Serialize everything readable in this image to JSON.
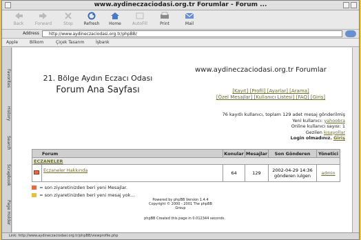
{
  "window": {
    "title": "www.aydineczaciodasi.org.tr Forumlar - Forum ..."
  },
  "toolbar": {
    "back": "Back",
    "forward": "Forward",
    "stop": "Stop",
    "refresh": "Refresh",
    "home": "Home",
    "autofill": "AutoFill",
    "print": "Print",
    "mail": "Mail"
  },
  "address": {
    "label": "Address",
    "url": "http://www.aydineczaciodasi.org.tr/phpBB/"
  },
  "bookmarks": [
    "Apple",
    "Bilkom",
    "Çiçek Tasarım",
    "İşbank"
  ],
  "sidebar_tabs": [
    "Favorites",
    "History",
    "Search",
    "Scrapbook",
    "Page Holder"
  ],
  "page": {
    "org_title": "21. Bölge Aydın Eczacı Odası",
    "forum_home": "Forum Ana Sayfası",
    "site_title": "www.aydineczaciodasi.org.tr Forumlar",
    "links_line1": "[Kayıt] [Profil] [Ayarlar] [Arama]",
    "links_line2": "[Özel Mesajlar] [Kullanıcı Listesi] [FAQ] [Giriş]",
    "stats_line1": "76 kayıtlı kullanıcı, toplam 129 adet mesaj gönderilmiş",
    "stats_newuser_label": "Yeni kullanıcı:",
    "stats_newuser_name": "yahoobra",
    "stats_online": "Online kullanıcı sayısı: 1",
    "stats_visitor_label": "Gezilen",
    "stats_visitor_name": "kısayollar",
    "stats_login_label": "Login olmadınız.",
    "stats_login_link": "Giriş",
    "table": {
      "headers": {
        "forum": "Forum",
        "topics": "Konular",
        "messages": "Mesajlar",
        "last": "Son Gönderen",
        "mod": "Yönetici"
      },
      "category": "ECZANELER",
      "row": {
        "name": "Eczaneler Hakkında",
        "topics": "64",
        "messages": "129",
        "last_date": "2002-04-29 14:36",
        "last_user": "gönderen iulgen",
        "mod": "admin"
      }
    },
    "legend_new": "= son ziyaretinizden beri yeni Mesajlar.",
    "legend_none": "= son ziyaretinizden beri yeni mesaj yok...",
    "powered_line1": "Powered by phpBB Version 1.4.4",
    "powered_line2": "Copyright © 2000 - 2001 The phpBB Group",
    "created": "phpBB Created this page in 0.012344 seconds."
  },
  "statusbar": {
    "text": "Link: http://www.aydineczaciodasi.org.tr/phpBB/viewprofile.php"
  },
  "colors": {
    "link": "#6b6b2a",
    "folder_new": "#e06a4a",
    "folder_old": "#e0c04a",
    "desktop": "#e6c34a"
  }
}
